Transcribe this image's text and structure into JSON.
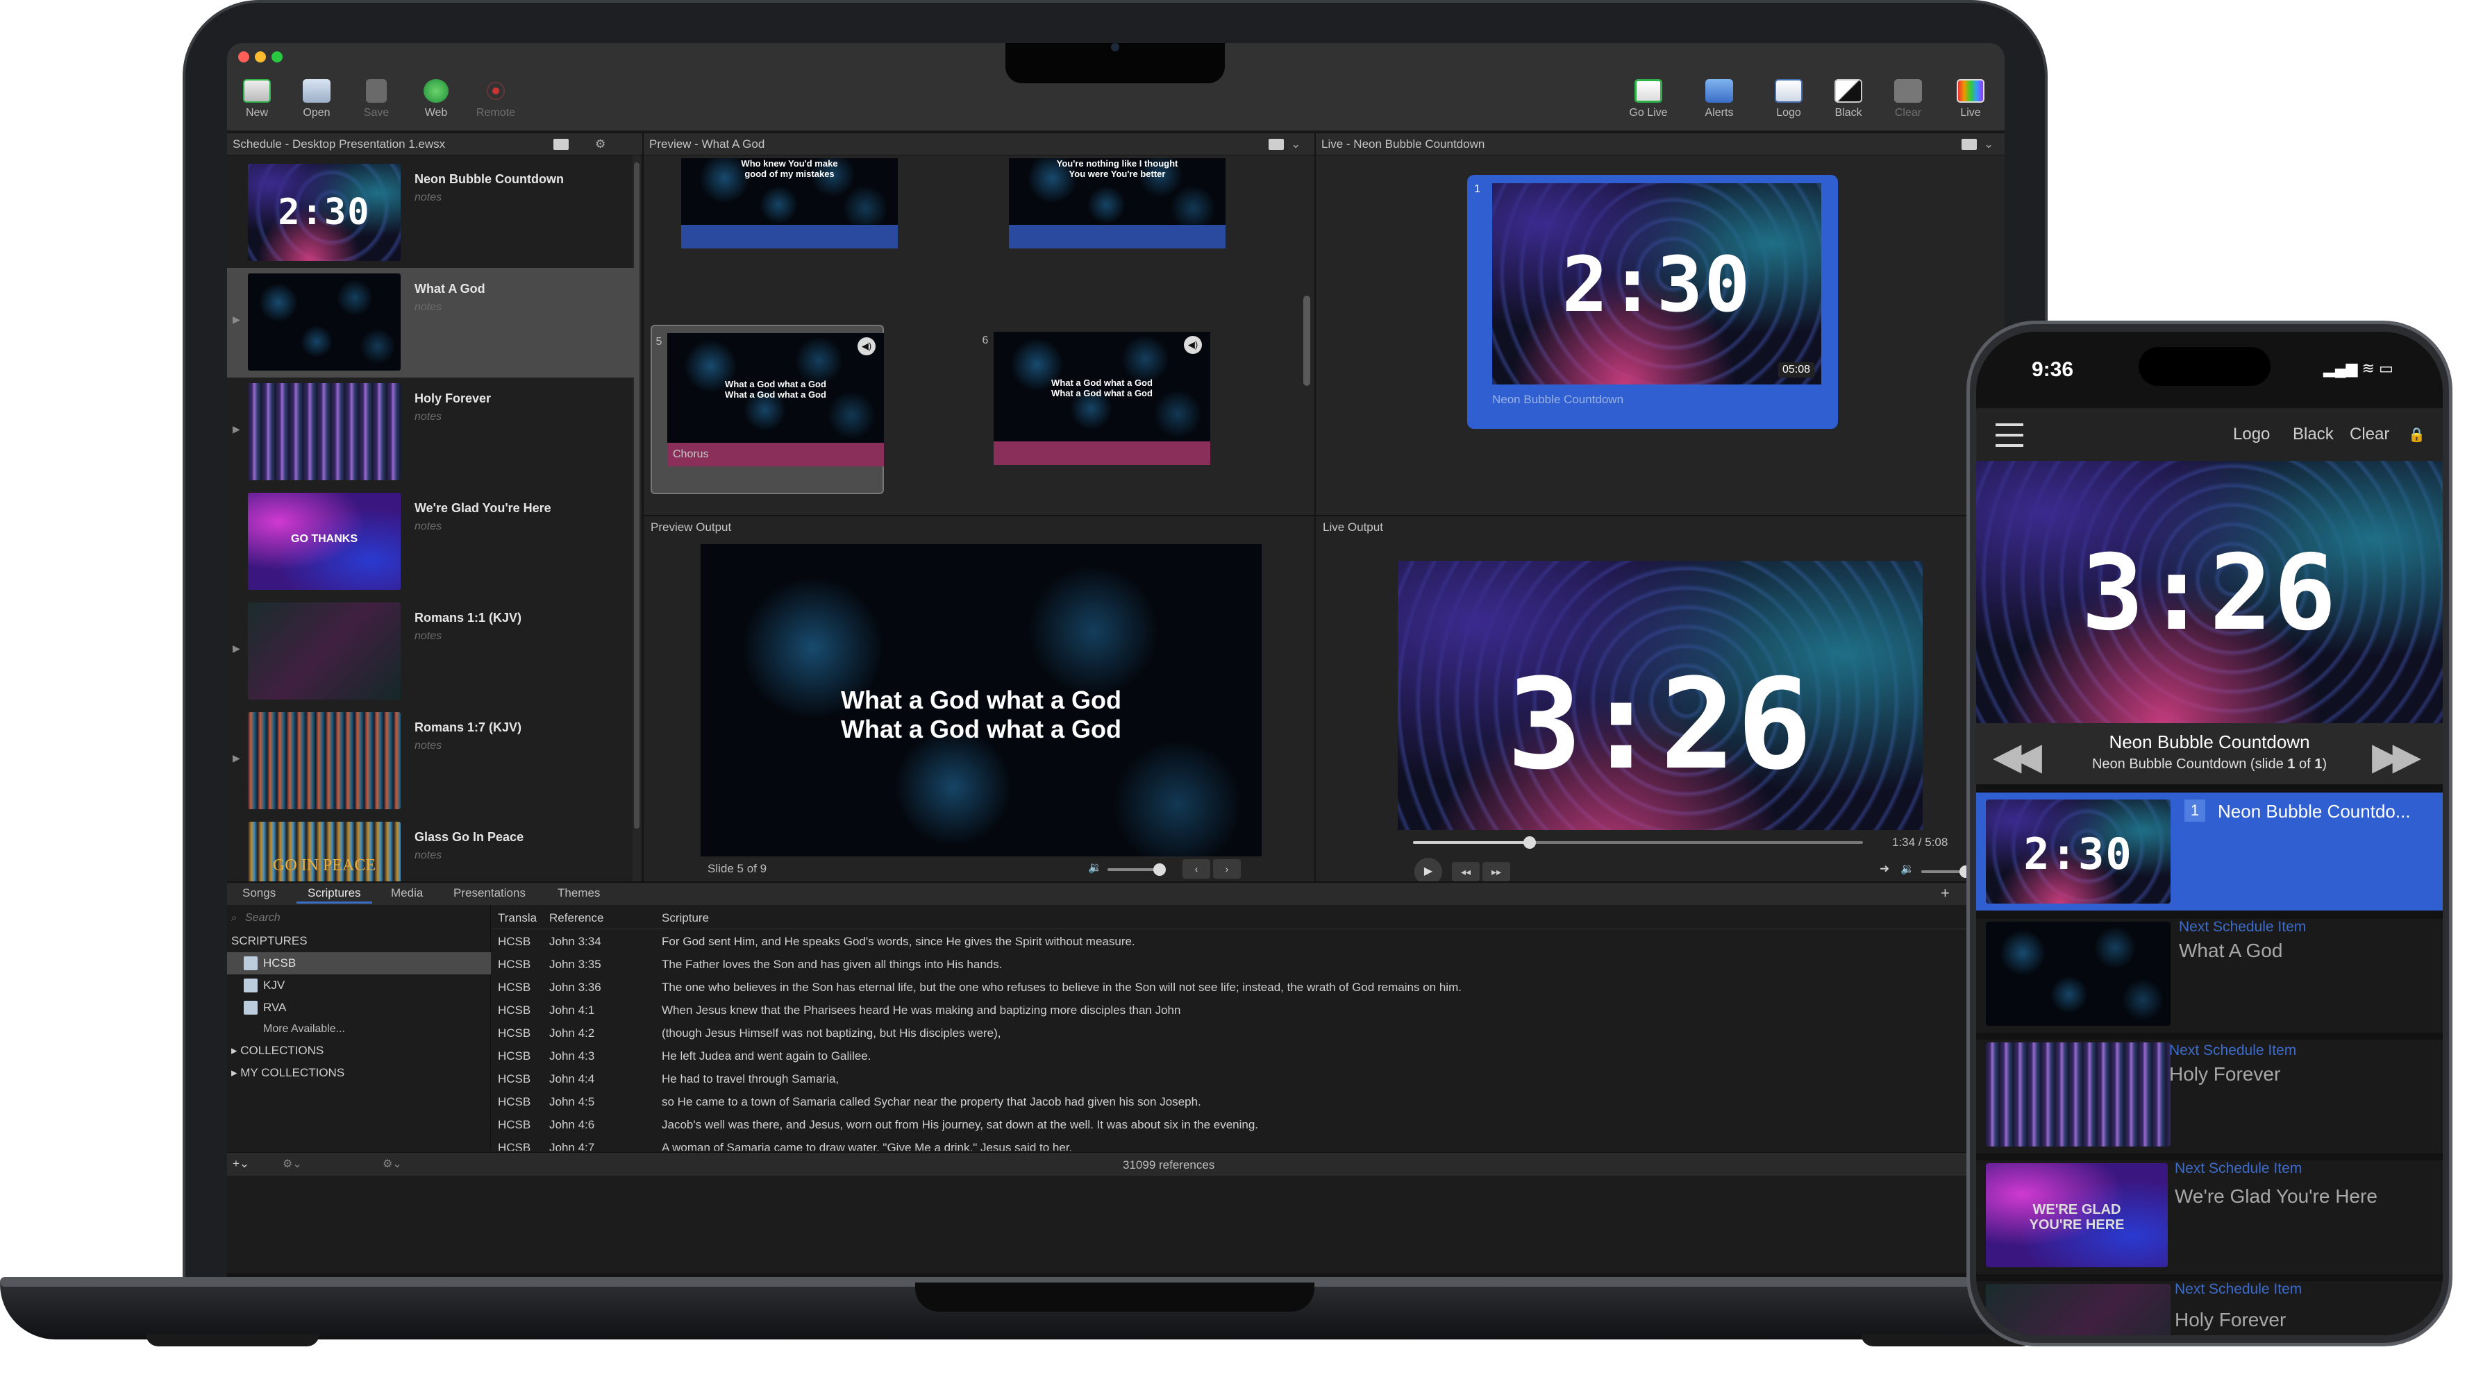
{
  "app": {
    "toolbar_left": [
      {
        "label": "New",
        "icon": "new-document-icon"
      },
      {
        "label": "Open",
        "icon": "open-folder-icon"
      },
      {
        "label": "Save",
        "icon": "save-icon"
      },
      {
        "label": "Web",
        "icon": "web-globe-icon"
      },
      {
        "label": "Remote",
        "icon": "remote-broadcast-icon"
      }
    ],
    "toolbar_right": [
      {
        "label": "Go Live",
        "icon": "go-live-icon"
      },
      {
        "label": "Alerts",
        "icon": "alerts-icon"
      },
      {
        "label": "Logo",
        "icon": "logo-icon"
      },
      {
        "label": "Black",
        "icon": "black-screen-icon"
      },
      {
        "label": "Clear",
        "icon": "clear-icon"
      },
      {
        "label": "Live",
        "icon": "live-monitor-icon"
      }
    ],
    "schedule": {
      "header": "Schedule - Desktop Presentation 1.ewsx",
      "items": [
        {
          "title": "Neon Bubble Countdown",
          "notes": "notes",
          "thumb_text": "2:30"
        },
        {
          "title": "What A God",
          "notes": "notes",
          "thumb_text": ""
        },
        {
          "title": "Holy Forever",
          "notes": "notes",
          "thumb_text": ""
        },
        {
          "title": "We're Glad You're Here",
          "notes": "notes",
          "thumb_text": "GO THANKS"
        },
        {
          "title": "Romans 1:1 (KJV)",
          "notes": "notes",
          "thumb_text": ""
        },
        {
          "title": "Romans 1:7 (KJV)",
          "notes": "notes",
          "thumb_text": ""
        },
        {
          "title": "Glass Go In Peace",
          "notes": "notes",
          "thumb_text": "GO IN PEACE"
        }
      ]
    },
    "preview": {
      "header": "Preview - What A God",
      "top_slides": [
        {
          "lyrics": "Who knew You'd make\ngood of my mistakes"
        },
        {
          "lyrics": "You're nothing like I thought\nYou were You're better"
        }
      ],
      "slides": [
        {
          "num": "5",
          "lyrics": "What a God what a God\nWhat a God what a God",
          "label": "Chorus"
        },
        {
          "num": "6",
          "lyrics": "What a God what a God\nWhat a God what a God",
          "label": ""
        }
      ],
      "output_header": "Preview Output",
      "output_line1": "What a God what a God",
      "output_line2": "What a God what a God",
      "slide_counter": "Slide 5 of 9"
    },
    "live": {
      "header": "Live - Neon Bubble Countdown",
      "card_num": "1",
      "card_timer": "2:30",
      "card_duration": "05:08",
      "card_title": "Neon Bubble Countdown",
      "output_header": "Live Output",
      "output_timer": "3:26",
      "time_readout": "1:34 / 5:08",
      "progress": 0.26,
      "volume": 0.8
    },
    "library": {
      "tabs": [
        "Songs",
        "Scriptures",
        "Media",
        "Presentations",
        "Themes"
      ],
      "active_tab": "Scriptures",
      "search_placeholder": "Search",
      "section_scriptures": "SCRIPTURES",
      "translations": [
        "HCSB",
        "KJV",
        "RVA"
      ],
      "more": "More Available...",
      "collections": "COLLECTIONS",
      "my_collections": "MY COLLECTIONS",
      "columns": [
        "Transla",
        "Reference",
        "Scripture"
      ],
      "rows": [
        [
          "HCSB",
          "John 3:34",
          "For God sent Him, and He speaks God's words, since He gives the Spirit without measure."
        ],
        [
          "HCSB",
          "John 3:35",
          "The Father loves the Son and has given all things into His hands."
        ],
        [
          "HCSB",
          "John 3:36",
          "The one who believes in the Son has eternal life, but the one who refuses to believe in the Son will not see life; instead, the wrath of God remains on him."
        ],
        [
          "HCSB",
          "John 4:1",
          "When Jesus knew that the Pharisees heard He was making and baptizing more disciples than John"
        ],
        [
          "HCSB",
          "John 4:2",
          "(though Jesus Himself was not baptizing, but His disciples were),"
        ],
        [
          "HCSB",
          "John 4:3",
          "He left Judea and went again to Galilee."
        ],
        [
          "HCSB",
          "John 4:4",
          "He had to travel through Samaria,"
        ],
        [
          "HCSB",
          "John 4:5",
          "so He came to a town of Samaria called Sychar near the property that Jacob had given his son Joseph."
        ],
        [
          "HCSB",
          "John 4:6",
          "Jacob's well was there, and Jesus, worn out from His journey, sat down at the well. It was about six in the evening."
        ],
        [
          "HCSB",
          "John 4:7",
          "A woman of Samaria came to draw water. \"Give Me a drink,\" Jesus said to her,"
        ]
      ],
      "count": "31099 references"
    }
  },
  "phone": {
    "time": "9:36",
    "buttons": [
      "Logo",
      "Black",
      "Clear"
    ],
    "live_timer": "3:26",
    "now_title": "Neon Bubble Countdown",
    "now_sub_prefix": "Neon Bubble Countdown (slide ",
    "now_sub_num": "1",
    "now_sub_mid": " of ",
    "now_sub_total": "1",
    "now_sub_suffix": ")",
    "current": {
      "num": "1",
      "title": "Neon Bubble Countdo...",
      "timer": "2:30"
    },
    "next_label": "Next Schedule Item",
    "next_items": [
      "What A God",
      "Holy Forever",
      "We're Glad You're Here",
      "Holy Forever"
    ],
    "glad_text_1": "WE'RE GLAD",
    "glad_text_2": "YOU'RE HERE"
  },
  "colors": {
    "accent": "#3b6ec8",
    "live_card": "#2f5fd0",
    "chorus": "#8a2f5a",
    "verse_bar": "#2a4aa0"
  }
}
